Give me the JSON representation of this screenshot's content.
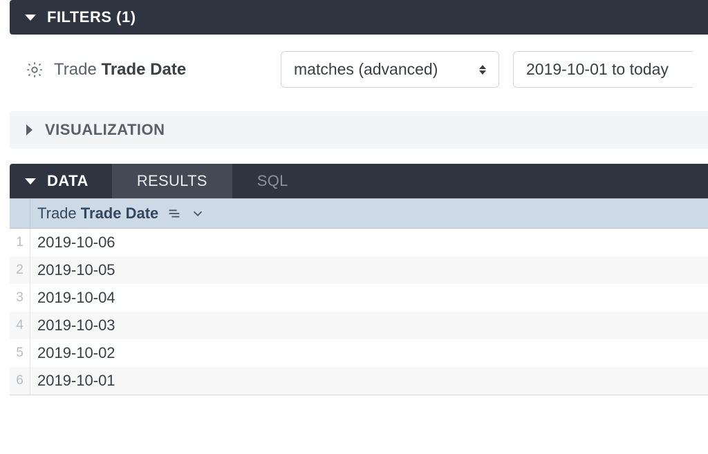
{
  "filters": {
    "header": "FILTERS (1)",
    "field_prefix": "Trade",
    "field_name": "Trade Date",
    "operator": "matches (advanced)",
    "value": "2019-10-01 to today"
  },
  "visualization": {
    "header": "VISUALIZATION"
  },
  "data": {
    "header": "DATA",
    "tabs": {
      "results": "RESULTS",
      "sql": "SQL"
    },
    "column": {
      "prefix": "Trade",
      "name": "Trade Date"
    },
    "rows": [
      "2019-10-06",
      "2019-10-05",
      "2019-10-04",
      "2019-10-03",
      "2019-10-02",
      "2019-10-01"
    ]
  }
}
